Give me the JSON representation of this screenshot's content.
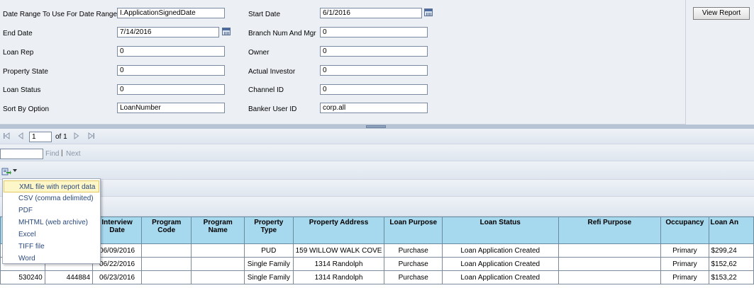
{
  "params": {
    "date_range_label": "Date Range To Use For Date Range",
    "date_range_value": "I.ApplicationSignedDate",
    "end_date_label": "End Date",
    "end_date_value": "7/14/2016",
    "loan_rep_label": "Loan Rep",
    "loan_rep_value": "0",
    "property_state_label": "Property State",
    "property_state_value": "0",
    "loan_status_label": "Loan Status",
    "loan_status_value": "0",
    "sort_by_label": "Sort By Option",
    "sort_by_value": "LoanNumber",
    "start_date_label": "Start Date",
    "start_date_value": "6/1/2016",
    "branch_label": "Branch Num And Mgr",
    "branch_value": "0",
    "owner_label": "Owner",
    "owner_value": "0",
    "actual_investor_label": "Actual Investor",
    "actual_investor_value": "0",
    "channel_label": "Channel ID",
    "channel_value": "0",
    "banker_label": "Banker User ID",
    "banker_value": "corp.all"
  },
  "view_report_label": "View Report",
  "pager": {
    "first_icon": "first-page-icon",
    "prev_icon": "previous-page-icon",
    "page_value": "1",
    "of_label": "of 1",
    "next_icon": "next-page-icon",
    "last_icon": "last-page-icon"
  },
  "find": {
    "find_label": "Find",
    "separator": "|",
    "next_label": "Next"
  },
  "export_menu": {
    "icon": "export-icon",
    "items": [
      "XML file with report data",
      "CSV (comma delimited)",
      "PDF",
      "MHTML (web archive)",
      "Excel",
      "TIFF file",
      "Word"
    ]
  },
  "table": {
    "headers": [
      "Interview Date",
      "Program Code",
      "Program Name",
      "Property Type",
      "Property Address",
      "Loan Purpose",
      "Loan Status",
      "Refi Purpose",
      "Occupancy",
      "Loan An"
    ],
    "rows": [
      {
        "c0": "",
        "c1": "",
        "interview_date": "06/09/2016",
        "program_code": "",
        "program_name": "",
        "property_type": "PUD",
        "property_address": "159 WILLOW WALK COVE",
        "loan_purpose": "Purchase",
        "loan_status": "Loan Application Created",
        "refi_purpose": "",
        "occupancy": "Primary",
        "loan_amount": "$299,24"
      },
      {
        "c0": "",
        "c1": "",
        "interview_date": "06/22/2016",
        "program_code": "",
        "program_name": "",
        "property_type": "Single Family",
        "property_address": "1314 Randolph",
        "loan_purpose": "Purchase",
        "loan_status": "Loan Application Created",
        "refi_purpose": "",
        "occupancy": "Primary",
        "loan_amount": "$152,62"
      },
      {
        "c0": "530240",
        "c1": "444884",
        "interview_date": "06/23/2016",
        "program_code": "",
        "program_name": "",
        "property_type": "Single Family",
        "property_address": "1314 Randolph",
        "loan_purpose": "Purchase",
        "loan_status": "Loan Application Created",
        "refi_purpose": "",
        "occupancy": "Primary",
        "loan_amount": "$153,22"
      }
    ]
  },
  "colors": {
    "header_bg": "#a6d8ee",
    "param_bg": "#ecf0f5",
    "menu_highlight": "#fdf6c8",
    "link_text": "#2b4a7c"
  }
}
